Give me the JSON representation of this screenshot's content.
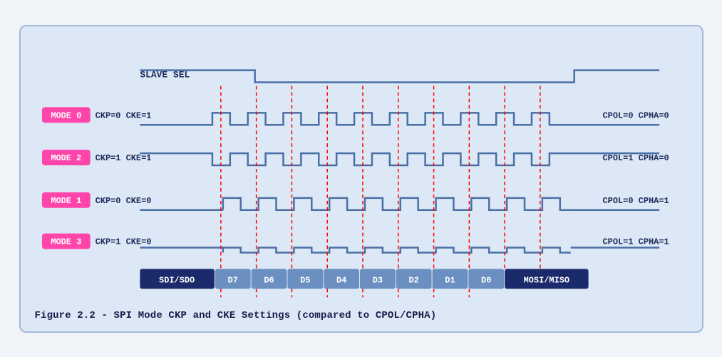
{
  "caption": "Figure 2.2 - SPI Mode CKP and CKE Settings (compared to CPOL/CPHA)",
  "diagram": {
    "slave_sel_label": "SLAVE SEL",
    "modes": [
      {
        "label": "MODE 0",
        "params": "CKP=0  CKE=1",
        "right": "CPOL=0  CPHA=0"
      },
      {
        "label": "MODE 2",
        "params": "CKP=1  CKE=1",
        "right": "CPOL=1  CPHA=0"
      },
      {
        "label": "MODE 1",
        "params": "CKP=0  CKE=0",
        "right": "CPOL=0  CPHA=1"
      },
      {
        "label": "MODE 3",
        "params": "CKP=1  CKE=0",
        "right": "CPOL=1  CPHA=1"
      }
    ],
    "data_labels": [
      "SDI/SDO",
      "D7",
      "D6",
      "D5",
      "D4",
      "D3",
      "D2",
      "D1",
      "D0",
      "MOSI/MISO"
    ]
  }
}
